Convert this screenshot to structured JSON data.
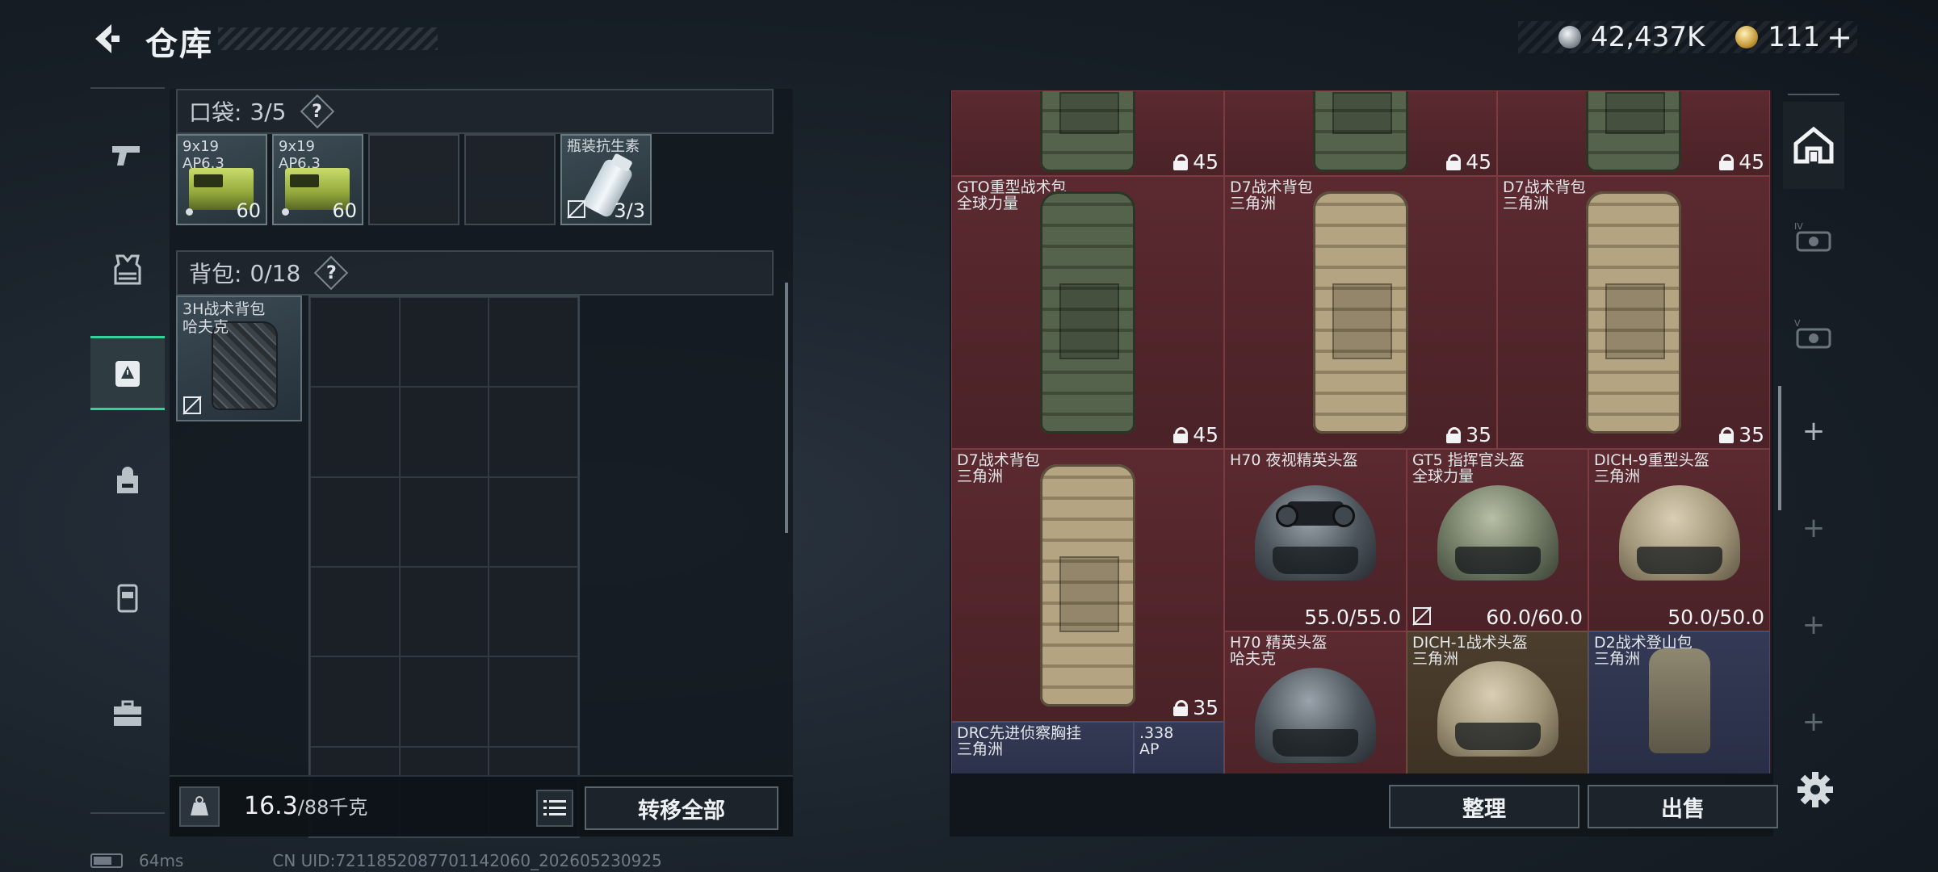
{
  "header": {
    "title": "仓库"
  },
  "currency": {
    "silver": "42,437K",
    "gold": "111",
    "plus": "+"
  },
  "pocket": {
    "label": "口袋:",
    "count": "3/5",
    "help": "?",
    "slots": [
      {
        "name_l1": "9x19",
        "name_l2": "AP6.3",
        "count": "60"
      },
      {
        "name_l1": "9x19",
        "name_l2": "AP6.3",
        "count": "60"
      },
      {
        "name_l1": "瓶装抗生素",
        "count": "3/3"
      }
    ]
  },
  "backpack": {
    "label": "背包:",
    "count": "0/18",
    "help": "?",
    "item": {
      "name_l1": "3H战术背包",
      "name_l2": "哈夫克"
    }
  },
  "footer_left": {
    "weight": "16.3",
    "weight_max": "/88千克",
    "transfer_all": "转移全部"
  },
  "status": {
    "ping": "64ms",
    "uid": "CN UID:7211852087701142060_202605230925"
  },
  "stash": {
    "top_row_caps": [
      "45",
      "45",
      "45"
    ],
    "items": [
      {
        "l1": "GTO重型战术包",
        "l2": "全球力量",
        "cap": "45"
      },
      {
        "l1": "D7战术背包",
        "l2": "三角洲",
        "cap": "35"
      },
      {
        "l1": "D7战术背包",
        "l2": "三角洲",
        "cap": "35"
      },
      {
        "l1": "D7战术背包",
        "l2": "三角洲",
        "cap": "35"
      },
      {
        "l1": "H70 夜视精英头盔",
        "l2": "",
        "dura": "55.0/55.0"
      },
      {
        "l1": "GT5 指挥官头盔",
        "l2": "全球力量",
        "dura": "60.0/60.0"
      },
      {
        "l1": "DICH-9重型头盔",
        "l2": "三角洲",
        "dura": "50.0/50.0"
      },
      {
        "l1": "H70 精英头盔",
        "l2": "哈夫克"
      },
      {
        "l1": "DICH-1战术头盔",
        "l2": "三角洲"
      },
      {
        "l1": "D2战术登山包",
        "l2": "三角洲"
      },
      {
        "l1": "DRC先进侦察胸挂",
        "l2": "三角洲"
      },
      {
        "l1": ".338",
        "l2": "AP"
      }
    ],
    "organize": "整理",
    "sell": "出售"
  },
  "right_tabs": {
    "plus": "+"
  },
  "colors": {
    "accent": "#31d39b",
    "cell_red": "#5b2a30",
    "cell_blue": "#343a55",
    "cell_gold": "#4c3e2d"
  }
}
